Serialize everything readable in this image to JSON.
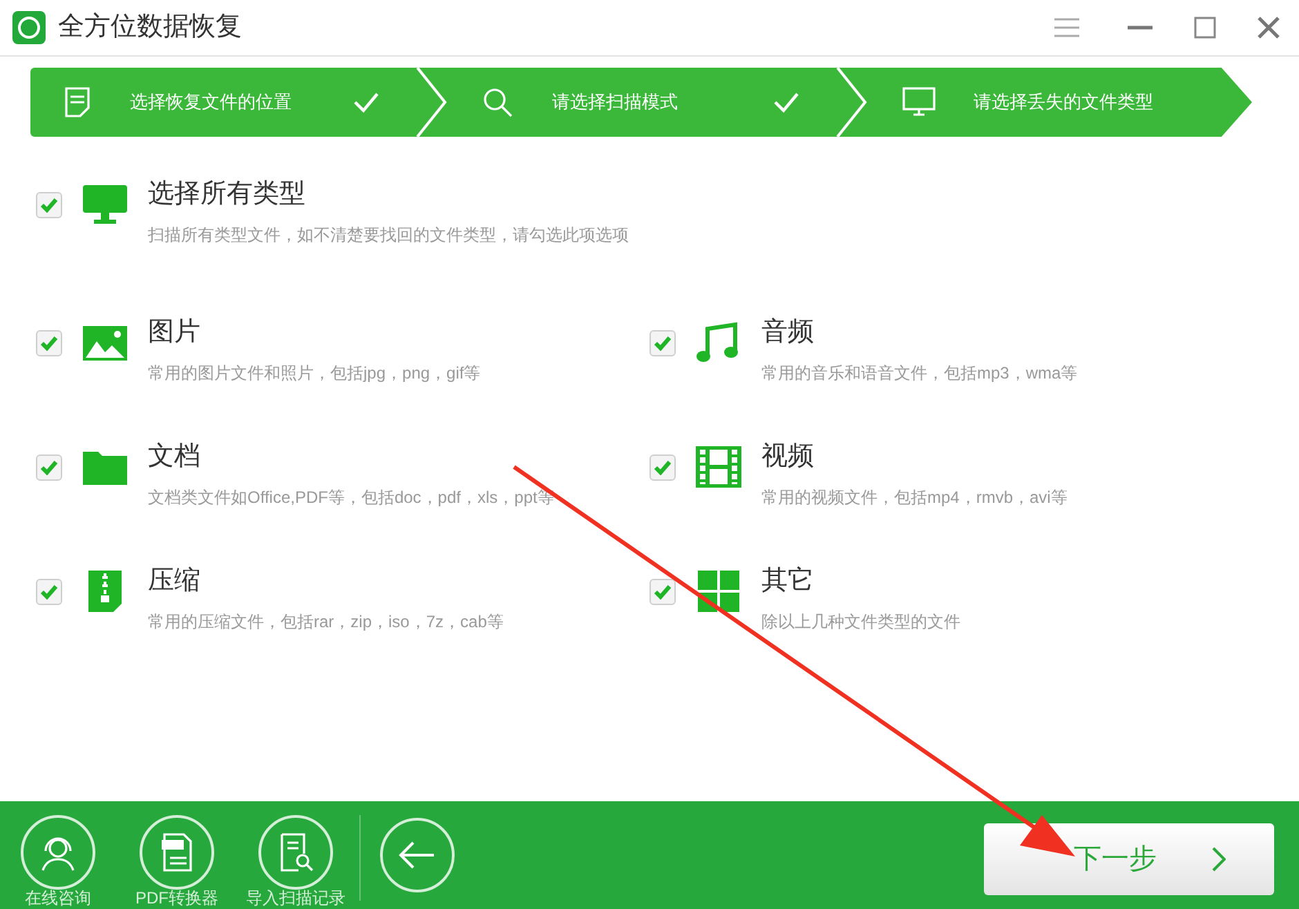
{
  "window": {
    "title": "全方位数据恢复"
  },
  "steps": [
    {
      "kind": "location",
      "label": "选择恢复文件的位置",
      "done": true
    },
    {
      "kind": "mode",
      "label": "请选择扫描模式",
      "done": true
    },
    {
      "kind": "type",
      "label": "请选择丢失的文件类型",
      "done": false
    }
  ],
  "all_types": {
    "kind": "all",
    "title": "选择所有类型",
    "description": "扫描所有类型文件，如不清楚要找回的文件类型，请勾选此项选项",
    "checked": true
  },
  "file_types": [
    {
      "kind": "image",
      "title": "图片",
      "description": "常用的图片文件和照片，包括jpg，png，gif等",
      "checked": true
    },
    {
      "kind": "audio",
      "title": "音频",
      "description": "常用的音乐和语音文件，包括mp3，wma等",
      "checked": true
    },
    {
      "kind": "document",
      "title": "文档",
      "description": "文档类文件如Office,PDF等，包括doc，pdf，xls，ppt等",
      "checked": true
    },
    {
      "kind": "video",
      "title": "视频",
      "description": "常用的视频文件，包括mp4，rmvb，avi等",
      "checked": true
    },
    {
      "kind": "archive",
      "title": "压缩",
      "description": "常用的压缩文件，包括rar，zip，iso，7z，cab等",
      "checked": true
    },
    {
      "kind": "other",
      "title": "其它",
      "description": "除以上几种文件类型的文件",
      "checked": true
    }
  ],
  "tools": [
    {
      "kind": "support",
      "label": "在线咨询"
    },
    {
      "kind": "pdf",
      "label": "PDF转换器"
    },
    {
      "kind": "import",
      "label": "导入扫描记录"
    }
  ],
  "next_button": {
    "label": "下一步"
  }
}
